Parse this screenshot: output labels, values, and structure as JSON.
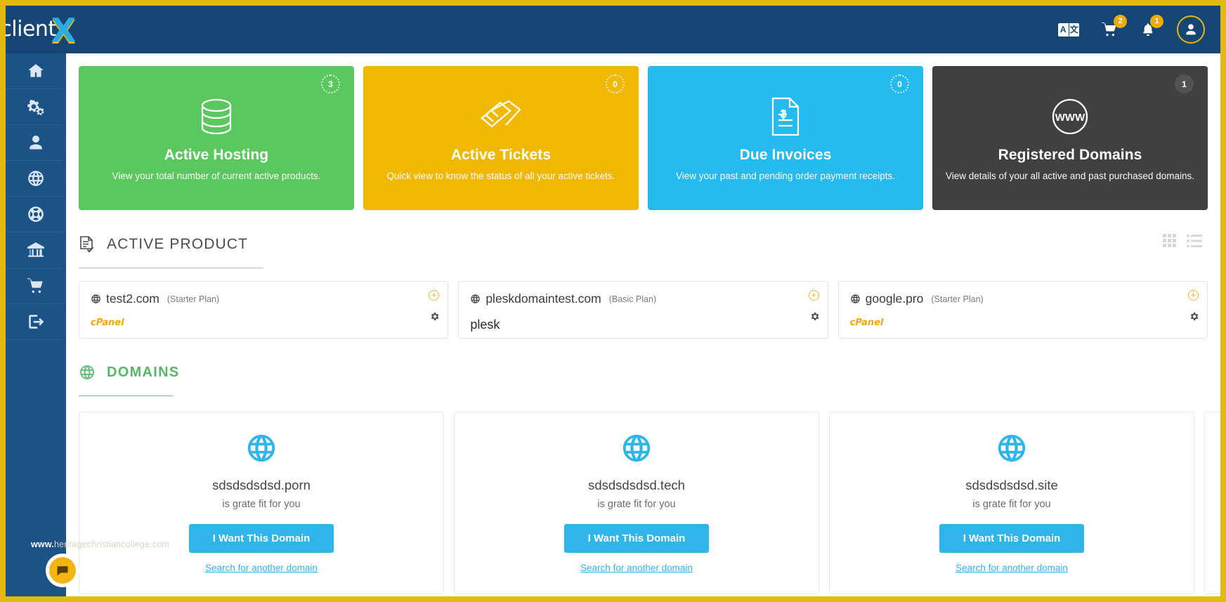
{
  "brand": {
    "text": "client",
    "x": "X"
  },
  "topbar": {
    "language_icon": "translate-icon",
    "language_left": "A",
    "language_right": "文",
    "cart_badge": "2",
    "bell_badge": "1",
    "avatar_icon": "user-icon"
  },
  "sidebar": {
    "items": [
      {
        "name": "home",
        "icon": "home-icon"
      },
      {
        "name": "services",
        "icon": "cogs-icon"
      },
      {
        "name": "account",
        "icon": "user-icon"
      },
      {
        "name": "domains",
        "icon": "globe-icon"
      },
      {
        "name": "support",
        "icon": "life-ring-icon"
      },
      {
        "name": "billing",
        "icon": "bank-icon"
      },
      {
        "name": "store",
        "icon": "shopping-cart-icon"
      },
      {
        "name": "logout",
        "icon": "sign-out-icon"
      }
    ]
  },
  "stats": [
    {
      "title": "Active Hosting",
      "subtitle": "View your total number of current active products.",
      "badge": "3",
      "color": "#5bc85f",
      "icon": "database-icon"
    },
    {
      "title": "Active Tickets",
      "subtitle": "Quick view to know the  status of all your active tickets.",
      "badge": "0",
      "color": "#f0b800",
      "icon": "tickets-icon"
    },
    {
      "title": "Due Invoices",
      "subtitle": "View your past and pending order payment receipts.",
      "badge": "0",
      "color": "#26bbee",
      "icon": "invoice-icon"
    },
    {
      "title": "Registered Domains",
      "subtitle": "View details of your all active and past purchased domains.",
      "badge": "1",
      "color": "#413f3f",
      "icon": "www-icon"
    }
  ],
  "active_product": {
    "heading": "ACTIVE PRODUCT",
    "heading_icon": "document-check-icon",
    "grid_view_icon": "grid-view-icon",
    "list_view_icon": "list-view-icon",
    "cards": [
      {
        "domain": "test2.com",
        "plan": "(Starter Plan)",
        "brand": "cPanel",
        "brand_type": "cpanel",
        "add_icon": "plus-circle-icon",
        "settings_icon": "gear-icon"
      },
      {
        "domain": "pleskdomaintest.com",
        "plan": "(Basic Plan)",
        "brand": "plesk",
        "brand_type": "plesk",
        "add_icon": "plus-circle-icon",
        "settings_icon": "gear-icon"
      },
      {
        "domain": "google.pro",
        "plan": "(Starter Plan)",
        "brand": "cPanel",
        "brand_type": "cpanel",
        "add_icon": "plus-circle-icon",
        "settings_icon": "gear-icon"
      }
    ]
  },
  "domains": {
    "heading": "DOMAINS",
    "heading_icon": "globe-icon",
    "cards": [
      {
        "name": "sdsdsdsdsd.porn",
        "tagline": "is grate fit for you",
        "button": "I Want This Domain",
        "link": "Search for another domain",
        "icon": "globe-icon"
      },
      {
        "name": "sdsdsdsdsd.tech",
        "tagline": "is grate fit for you",
        "button": "I Want This Domain",
        "link": "Search for another domain",
        "icon": "globe-icon"
      },
      {
        "name": "sdsdsdsdsd.site",
        "tagline": "is grate fit for you",
        "button": "I Want This Domain",
        "link": "Search for another domain",
        "icon": "globe-icon"
      }
    ]
  },
  "watermark": {
    "bold": "www.",
    "rest": "heritagechristiancollege.com"
  },
  "chat": {
    "icon": "chat-bubble-icon"
  },
  "colors": {
    "brand_blue": "#164574",
    "sidebar_blue": "#1c5286",
    "accent_yellow": "#e3b80f",
    "green": "#5bc85f",
    "orange": "#f0b800",
    "cyan": "#26bbee",
    "dark": "#413f3f",
    "link_blue": "#2fb5e8"
  }
}
